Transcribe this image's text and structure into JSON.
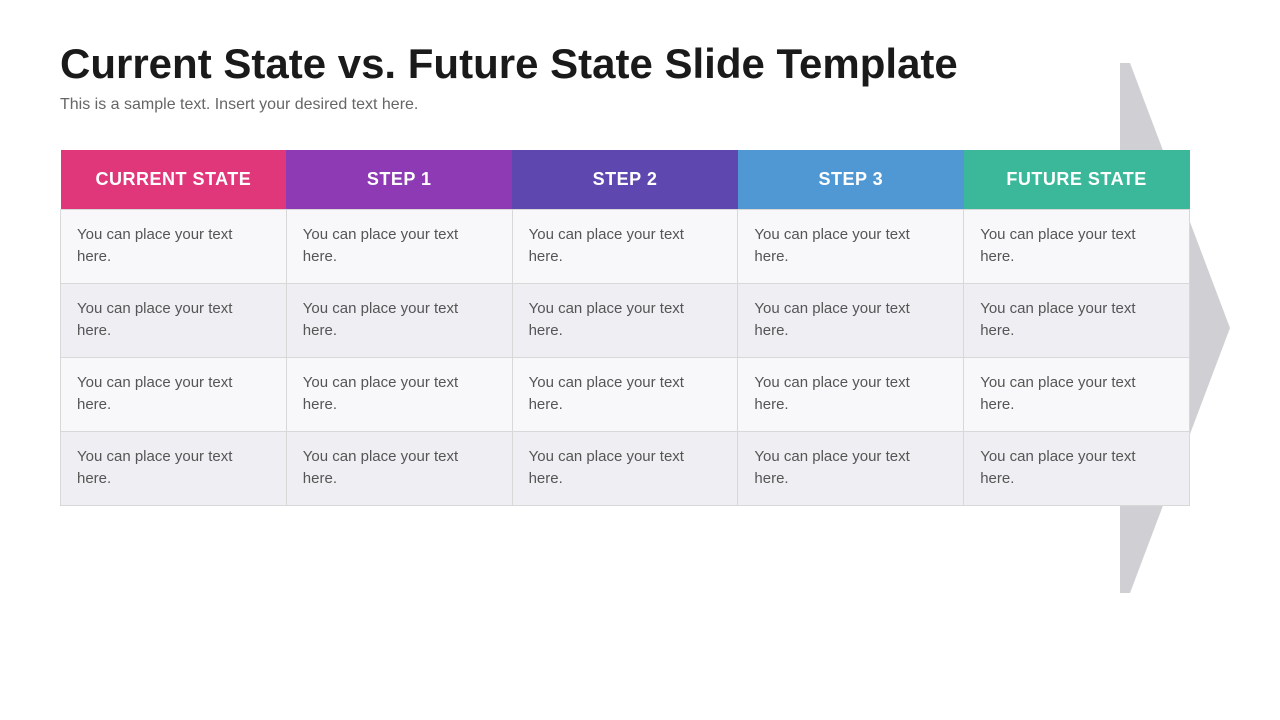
{
  "title": "Current State vs. Future State Slide Template",
  "subtitle": "This is a sample text. Insert your desired text here.",
  "headers": [
    {
      "id": "col-current",
      "label": "CURRENT STATE"
    },
    {
      "id": "col-step1",
      "label": "STEP 1"
    },
    {
      "id": "col-step2",
      "label": "STEP 2"
    },
    {
      "id": "col-step3",
      "label": "STEP 3"
    },
    {
      "id": "col-future",
      "label": "FUTURE STATE"
    }
  ],
  "rows": [
    [
      "You can place your text here.",
      "You can place your text here.",
      "You can place your text here.",
      "You can place your text here.",
      "You can place your text here."
    ],
    [
      "You can place your text here.",
      "You can place your text here.",
      "You can place your text here.",
      "You can place your text here.",
      "You can place your text here."
    ],
    [
      "You can place your text here.",
      "You can place your text here.",
      "You can place your text here.",
      "You can place your text here.",
      "You can place your text here."
    ],
    [
      "You can place your text here.",
      "You can place your text here.",
      "You can place your text here.",
      "You can place your text here.",
      "You can place your text here."
    ]
  ]
}
